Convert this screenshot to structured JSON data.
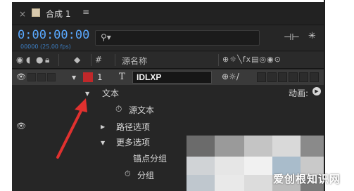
{
  "window": {
    "close_glyph": "×",
    "comp_name": "合成 1",
    "menu_glyph": "≡"
  },
  "timebar": {
    "timecode": "0:00:00:00",
    "fps": "00000 (25.00 fps)",
    "search_placeholder": ""
  },
  "columns": {
    "av_switches_icons": [
      "eye-icon",
      "audio-icon",
      "solo-icon",
      "lock-icon"
    ],
    "label_icon": "tag-icon",
    "index": "#",
    "source_name": "源名称",
    "switches": "⊕☼╲fx▤◎◉⊙"
  },
  "layer": {
    "number": "1",
    "type_glyph": "T",
    "name": "IDLXP",
    "switch_glyphs": "⊕☼/",
    "label_color": "#c0282a"
  },
  "properties": {
    "text_group": "文本",
    "source_text": "源文本",
    "path_options": "路径选项",
    "more_options": "更多选项",
    "anchor_grouping": "锚点分组",
    "animate_label": "动画:",
    "clipped_row": "分组"
  },
  "watermark": "爱创根知识网"
}
